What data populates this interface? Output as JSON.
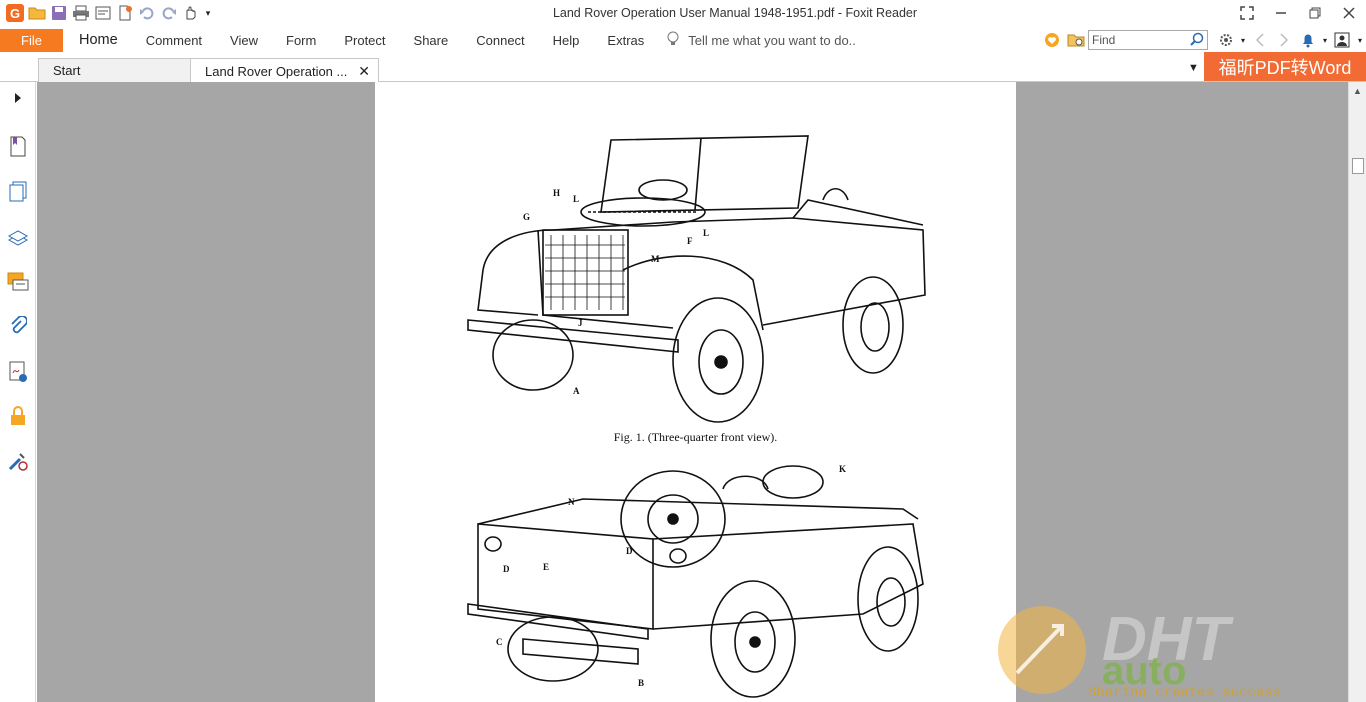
{
  "window": {
    "title": "Land Rover Operation User Manual 1948-1951.pdf - Foxit Reader"
  },
  "ribbon": {
    "file_label": "File",
    "tabs": [
      "Home",
      "Comment",
      "View",
      "Form",
      "Protect",
      "Share",
      "Connect",
      "Help",
      "Extras"
    ],
    "tell_me": "Tell me what you want to do..",
    "find_placeholder": "Find"
  },
  "doc_tabs": {
    "start": "Start",
    "current": "Land Rover Operation ..."
  },
  "promo": {
    "label": "福昕PDF转Word"
  },
  "document": {
    "fig1_caption": "Fig. 1. (Three-quarter front view).",
    "fig1_labels": [
      "H",
      "L",
      "G",
      "L",
      "F",
      "M",
      "J",
      "A"
    ],
    "fig2_labels": [
      "K",
      "N",
      "D",
      "E",
      "D",
      "C",
      "B"
    ]
  },
  "watermark": {
    "brand": "DHT",
    "sub": "auto",
    "tagline": "Sharing creates success"
  },
  "colors": {
    "accent": "#f57a20",
    "promo": "#f26b34",
    "workspace": "#a6a6a6"
  }
}
